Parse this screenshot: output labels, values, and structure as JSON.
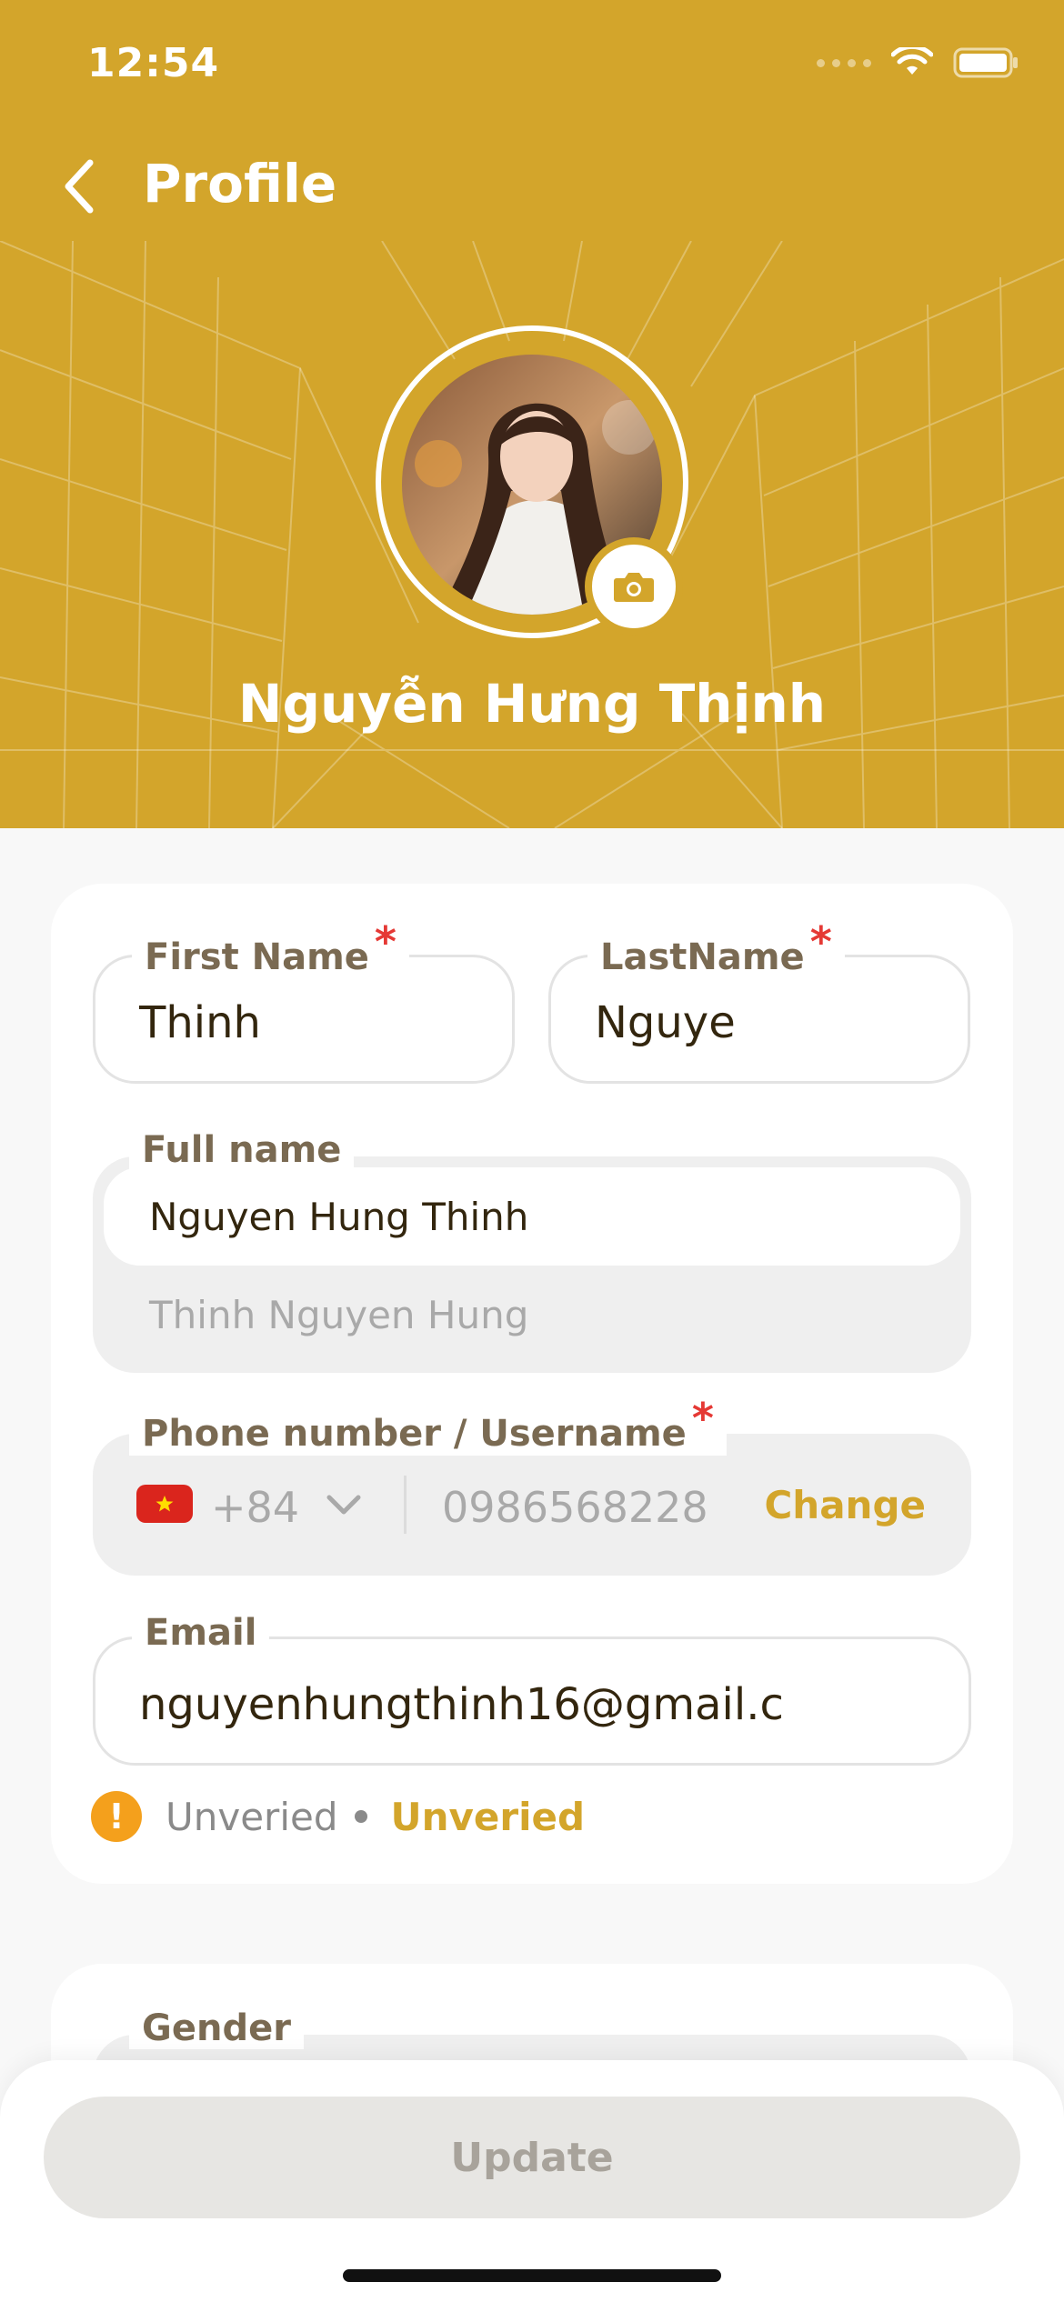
{
  "status_bar": {
    "time": "12:54"
  },
  "header": {
    "title": "Profile",
    "display_name": "Nguyễn Hưng Thịnh",
    "background_color": "#d3a52b"
  },
  "icons": {
    "back": "chevron-left-icon",
    "camera": "camera-icon",
    "dropdown": "chevron-down-icon",
    "warning": "exclamation-icon",
    "wifi": "wifi-icon",
    "battery": "battery-icon"
  },
  "form": {
    "first_name": {
      "label": "First Name",
      "required": "*",
      "value": "Thinh"
    },
    "last_name": {
      "label": "LastName",
      "required": "*",
      "value": "Nguye"
    },
    "full_name": {
      "label": "Full name",
      "value": "Nguyen Hung Thinh",
      "alt_value": "Thinh Nguyen Hung"
    },
    "phone": {
      "label": "Phone number / Username",
      "required": "*",
      "country_code": "+84",
      "number": "0986568228",
      "change_label": "Change"
    },
    "email": {
      "label": "Email",
      "value": "nguyenhungthinh16@gmail.c",
      "status": "Unveried",
      "action": "Unveried",
      "warning_glyph": "!"
    },
    "gender": {
      "label": "Gender"
    }
  },
  "footer": {
    "update_label": "Update"
  },
  "colors": {
    "accent": "#d3a52b",
    "required": "#e53935",
    "warning": "#f4a01c",
    "disabled_button": "#e7e6e3"
  }
}
